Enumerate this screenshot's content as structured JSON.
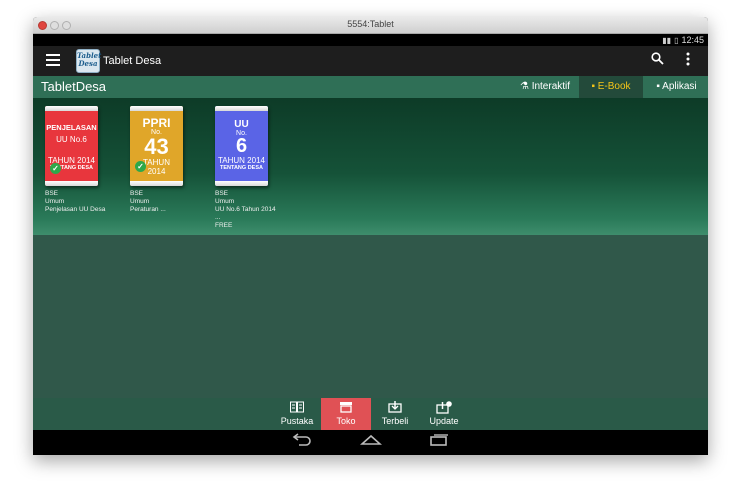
{
  "window": {
    "title": "5554:Tablet"
  },
  "status": {
    "time": "12:45",
    "signal_icon": "signal-icon",
    "battery_icon": "battery-icon"
  },
  "actionbar": {
    "app_name": "Tablet Desa",
    "logo_text": "Tablet Desa",
    "menu_icon": "hamburger-icon",
    "search_icon": "search-icon",
    "overflow_icon": "overflow-menu-icon"
  },
  "tabbar": {
    "title": "TabletDesa",
    "tabs": [
      {
        "label": "Interaktif",
        "icon": "flask-icon"
      },
      {
        "label": "E-Book",
        "icon": "book-icon",
        "active": true
      },
      {
        "label": "Aplikasi",
        "icon": "app-icon"
      }
    ]
  },
  "books": [
    {
      "cover_lines": [
        "PENJELASAN",
        "UU No.6",
        "TAHUN 2014",
        "TENTANG DESA"
      ],
      "cover_color": "#e8363d",
      "owned": true,
      "meta": [
        "BSE",
        "Umum",
        "Penjelasan UU Desa"
      ]
    },
    {
      "cover_lines": [
        "PPRI",
        "No.",
        "43",
        "TAHUN",
        "2014"
      ],
      "cover_color": "#e0a629",
      "owned": true,
      "meta": [
        "BSE",
        "Umum",
        "Peraturan ..."
      ]
    },
    {
      "cover_lines": [
        "UU",
        "No.",
        "6",
        "TAHUN 2014",
        "TENTANG DESA"
      ],
      "cover_color": "#5a64e6",
      "owned": false,
      "meta": [
        "BSE",
        "Umum",
        "UU No.6 Tahun 2014",
        "...",
        "FREE"
      ]
    }
  ],
  "bottomnav": [
    {
      "label": "Pustaka",
      "icon": "library-icon"
    },
    {
      "label": "Toko",
      "icon": "store-icon",
      "active": true
    },
    {
      "label": "Terbeli",
      "icon": "download-icon"
    },
    {
      "label": "Update",
      "icon": "update-icon"
    }
  ],
  "sysnav": {
    "back": "back-icon",
    "home": "home-icon",
    "recents": "recents-icon"
  },
  "colors": {
    "accent": "#2f6f56",
    "active_nav": "#e05155",
    "active_tab_text": "#f5c518"
  }
}
